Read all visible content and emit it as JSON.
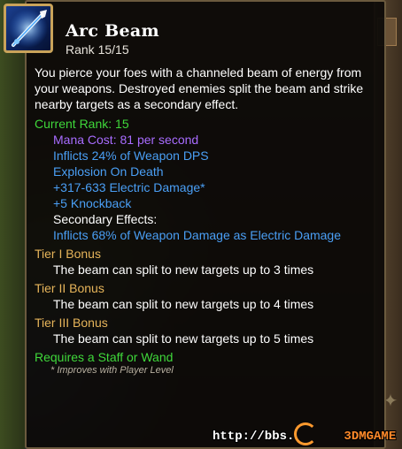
{
  "skill": {
    "name": "Arc Beam",
    "rank": "Rank 15/15",
    "description": "You pierce your foes with a channeled beam of energy from your weapons. Destroyed enemies split the beam and strike nearby targets as a secondary effect."
  },
  "current_rank": {
    "label": "Current Rank: 15",
    "mana_cost": "Mana Cost: 81 per second",
    "effects": [
      "Inflicts 24% of Weapon DPS",
      "Explosion On Death",
      "+317-633 Electric Damage*",
      "+5 Knockback"
    ],
    "secondary_label": "Secondary Effects:",
    "secondary_effect": "Inflicts 68% of Weapon Damage as Electric Damage"
  },
  "tiers": [
    {
      "label": "Tier I Bonus",
      "text": "The beam can split to new targets up to 3 times"
    },
    {
      "label": "Tier II Bonus",
      "text": "The beam can split to new targets up to 4 times"
    },
    {
      "label": "Tier III Bonus",
      "text": "The beam can split to new targets up to 5 times"
    }
  ],
  "requirement": "Requires a Staff or Wand",
  "footnote": "* Improves with Player Level",
  "watermark": {
    "prefix": "http://bbs.",
    "suffix": "3DMGAME"
  },
  "colors": {
    "green": "#3fd83a",
    "purple": "#a86cff",
    "blue": "#4a9ff5",
    "tan": "#e6b45a",
    "icon_frame": "#c9a35a"
  },
  "icons": {
    "skill_icon": "glowing-blue-wand-icon"
  }
}
